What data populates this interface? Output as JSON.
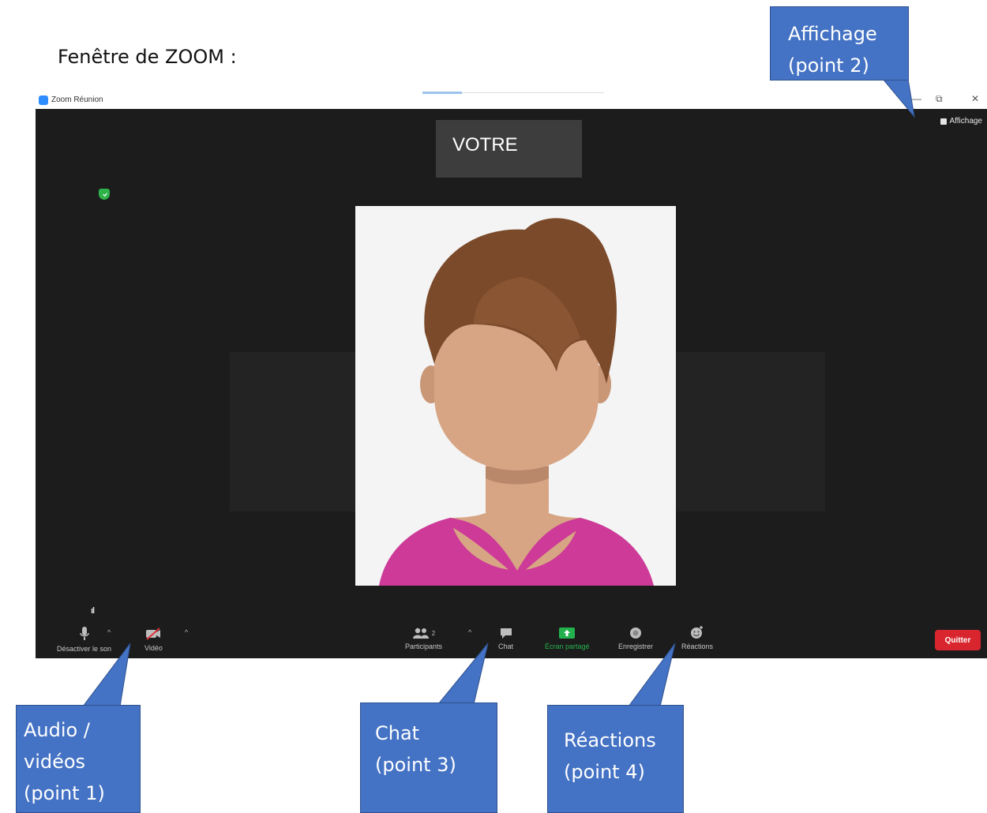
{
  "document": {
    "heading": "Fenêtre de ZOOM :"
  },
  "window": {
    "title": "Zoom Réunion",
    "minimize": "—",
    "restore": "⧉",
    "close": "✕",
    "view_button": "Affichage"
  },
  "video": {
    "name_label": "VOTRE"
  },
  "toolbar": {
    "mute_label": "Désactiver le son",
    "video_label": "Vidéo",
    "participants_label": "Participants",
    "participants_count": "2",
    "chat_label": "Chat",
    "share_label": "Écran partagé",
    "record_label": "Enregistrer",
    "reactions_label": "Réactions",
    "leave_label": "Quitter",
    "caret": "^",
    "signal": "ıl"
  },
  "callouts": {
    "view": "Affichage\n(point 2)",
    "audio_video": "Audio /\nvidéos\n(point 1)",
    "chat": "Chat\n(point 3)",
    "reactions": "Réactions\n(point 4)"
  },
  "colors": {
    "callout": "#4472c4",
    "share_green": "#23b14d",
    "quit_red": "#d9262e",
    "shirt": "#cd3a98",
    "hair": "#7b4a2a",
    "skin": "#d7a584"
  }
}
